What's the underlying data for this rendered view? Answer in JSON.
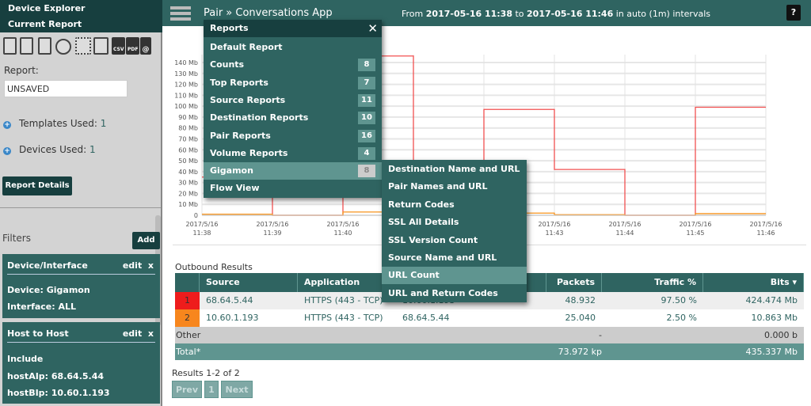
{
  "sidebar": {
    "title": "Device Explorer",
    "subtitle": "Current Report",
    "toolbar_icons": [
      "trash-icon",
      "save-icon",
      "save-as-icon",
      "clock-icon",
      "grid-icon",
      "print-icon",
      "csv-icon",
      "pdf-icon",
      "email-icon"
    ],
    "icon_texts": {
      "csv": "CSV",
      "pdf": "PDF",
      "email": "@"
    },
    "report_label": "Report:",
    "report_value": "UNSAVED",
    "templates_label": "Templates Used:",
    "templates_count": "1",
    "devices_label": "Devices Used:",
    "devices_count": "1",
    "report_details": "Report Details",
    "filters_label": "Filters",
    "add_label": "Add",
    "filters": [
      {
        "title": "Device/Interface",
        "edit": "edit",
        "close": "x",
        "lines": [
          "Device: Gigamon",
          "Interface: ALL"
        ]
      },
      {
        "title": "Host to Host",
        "edit": "edit",
        "close": "x",
        "lines": [
          "Include",
          "hostAIp: 68.64.5.44",
          "hostBIp: 10.60.1.193"
        ]
      }
    ]
  },
  "header": {
    "title": "Pair » Conversations App",
    "from": "From",
    "start": "2017-05-16 11:38",
    "to": "to",
    "end": "2017-05-16 11:46",
    "interval": "in auto (1m) intervals",
    "help": "?"
  },
  "menu": {
    "title": "Reports",
    "close": "✕",
    "items": [
      {
        "label": "Default Report",
        "count": ""
      },
      {
        "label": "Counts",
        "count": "8"
      },
      {
        "label": "Top Reports",
        "count": "7"
      },
      {
        "label": "Source Reports",
        "count": "11"
      },
      {
        "label": "Destination Reports",
        "count": "10"
      },
      {
        "label": "Pair Reports",
        "count": "16"
      },
      {
        "label": "Volume Reports",
        "count": "4"
      },
      {
        "label": "Gigamon",
        "count": "8"
      },
      {
        "label": "Flow View",
        "count": ""
      }
    ],
    "active": "Gigamon",
    "submenu": [
      "Destination Name and URL",
      "Pair Names and URL",
      "Return Codes",
      "SSL All Details",
      "SSL Version Count",
      "Source Name and URL",
      "URL Count",
      "URL and Return Codes"
    ],
    "submenu_active": "URL Count"
  },
  "chart_data": {
    "type": "line",
    "step": true,
    "x": [
      "2017/5/16 11:38",
      "2017/5/16 11:39",
      "2017/5/16 11:40",
      "2017/5/16 11:41",
      "2017/5/16 11:42",
      "2017/5/16 11:43",
      "2017/5/16 11:44",
      "2017/5/16 11:45",
      "2017/5/16 11:46"
    ],
    "y_ticks": [
      "0",
      "10 Mb",
      "20 Mb",
      "30 Mb",
      "40 Mb",
      "50 Mb",
      "60 Mb",
      "70 Mb",
      "80 Mb",
      "90 Mb",
      "100 Mb",
      "110 Mb",
      "120 Mb",
      "130 Mb",
      "140 Mb"
    ],
    "ylim": [
      0,
      150
    ],
    "unit": "Mb",
    "grid": true,
    "series": [
      {
        "color": "#f25050",
        "values": [
          35,
          0,
          150,
          0,
          97,
          42,
          0,
          99
        ]
      },
      {
        "color": "#f7941d",
        "values": [
          1,
          0,
          3,
          1,
          2,
          0.5,
          0,
          1.5
        ]
      }
    ]
  },
  "results": {
    "title": "Outbound Results",
    "columns": [
      "",
      "Source",
      "Application",
      "",
      "Packets ⇕",
      "Traffic %",
      "Bits ▾"
    ],
    "rows": [
      {
        "idx": "1",
        "color": "#ee1c1c",
        "source": "68.64.5.44",
        "app": "HTTPS (443 - TCP)",
        "dest": "10.60.1.193",
        "packets": "48.932 kp",
        "traffic": "97.50 %",
        "bits": "424.474 Mb"
      },
      {
        "idx": "2",
        "color": "#f7861d",
        "source": "10.60.1.193",
        "app": "HTTPS (443 - TCP)",
        "dest": "68.64.5.44",
        "packets": "25.040 kp",
        "traffic": "2.50 %",
        "bits": "10.863 Mb"
      }
    ],
    "other": {
      "label": "Other",
      "packets": "-",
      "bits": "0.000 b"
    },
    "total": {
      "label": "Total*",
      "packets": "73.972 kp",
      "bits": "435.337 Mb"
    },
    "summary": "Results 1-2 of 2",
    "pager": {
      "prev": "Prev",
      "page": "1",
      "next": "Next"
    }
  }
}
